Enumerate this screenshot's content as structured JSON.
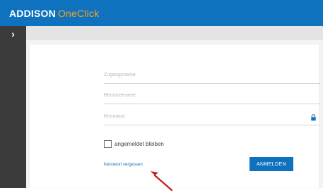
{
  "brand": {
    "main": "ADDISON",
    "sub": "OneClick"
  },
  "sidebar": {
    "toggle": "›"
  },
  "form": {
    "access_name_placeholder": "Zugangsname",
    "username_placeholder": "Benutzername",
    "password_placeholder": "Kennwort",
    "remember_label": "angemeldet bleiben",
    "forgot_password": "Kennwort vergessen",
    "login_button": "ANMELDEN"
  },
  "colors": {
    "topbar": "#0f72be",
    "accent": "#f7a21b",
    "sidebar": "#3b3b3b",
    "annotation_arrow": "#c81b1b"
  }
}
